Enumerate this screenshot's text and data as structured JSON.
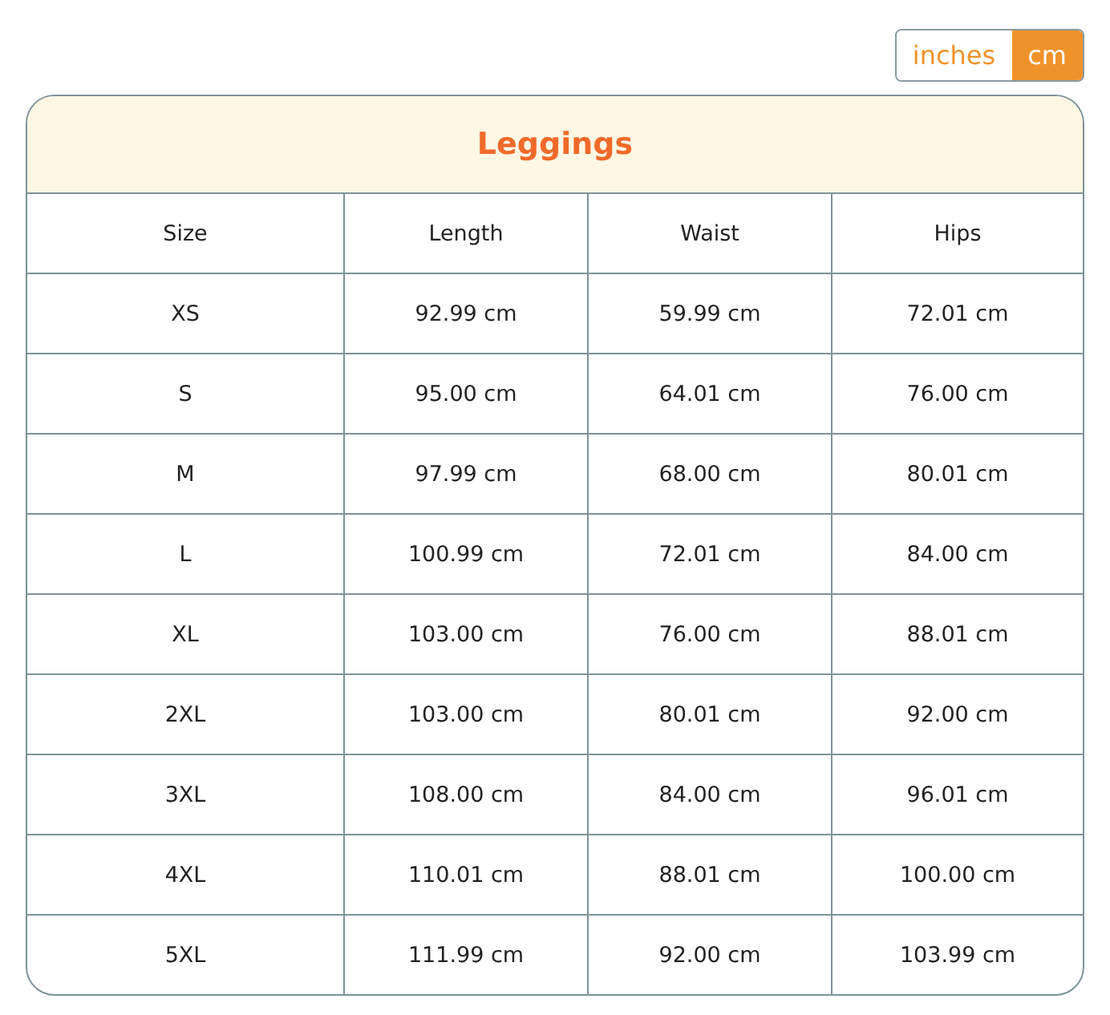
{
  "unit_toggle": [
    {
      "label": "inches",
      "selected": false
    },
    {
      "label": "cm",
      "selected": true
    }
  ],
  "table": {
    "title": "Leggings",
    "columns": [
      "Size",
      "Length",
      "Waist",
      "Hips"
    ],
    "rows": [
      [
        "XS",
        "92.99 cm",
        "59.99 cm",
        "72.01 cm"
      ],
      [
        "S",
        "95.00 cm",
        "64.01 cm",
        "76.00 cm"
      ],
      [
        "M",
        "97.99 cm",
        "68.00 cm",
        "80.01 cm"
      ],
      [
        "L",
        "100.99 cm",
        "72.01 cm",
        "84.00 cm"
      ],
      [
        "XL",
        "103.00 cm",
        "76.00 cm",
        "88.01 cm"
      ],
      [
        "2XL",
        "103.00 cm",
        "80.01 cm",
        "92.00 cm"
      ],
      [
        "3XL",
        "108.00 cm",
        "84.00 cm",
        "96.01 cm"
      ],
      [
        "4XL",
        "110.01 cm",
        "88.01 cm",
        "100.00 cm"
      ],
      [
        "5XL",
        "111.99 cm",
        "92.00 cm",
        "103.99 cm"
      ]
    ]
  }
}
